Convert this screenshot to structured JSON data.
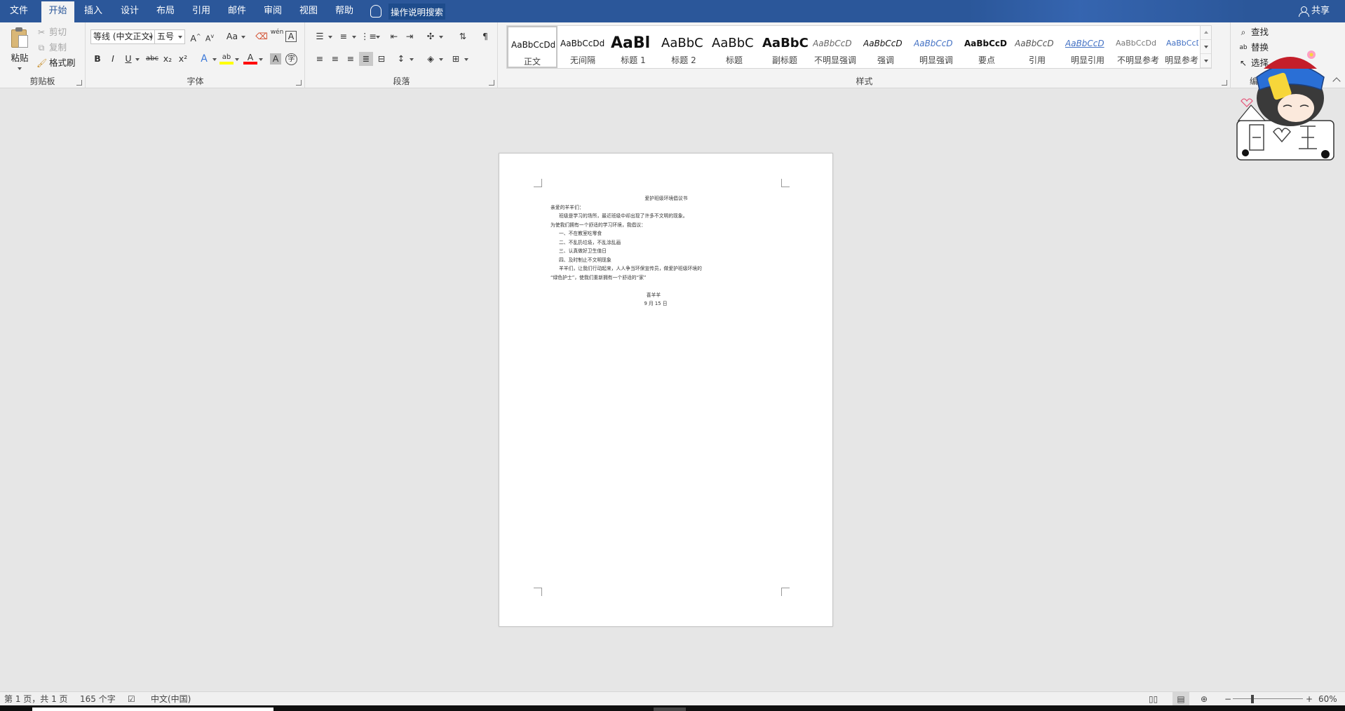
{
  "tabs": [
    {
      "label": "文件",
      "active": false
    },
    {
      "label": "开始",
      "active": true
    },
    {
      "label": "插入",
      "active": false
    },
    {
      "label": "设计",
      "active": false
    },
    {
      "label": "布局",
      "active": false
    },
    {
      "label": "引用",
      "active": false
    },
    {
      "label": "邮件",
      "active": false
    },
    {
      "label": "审阅",
      "active": false
    },
    {
      "label": "视图",
      "active": false
    },
    {
      "label": "帮助",
      "active": false
    }
  ],
  "tell_me": "操作说明搜索",
  "share": "共享",
  "clipboard": {
    "paste": "粘贴",
    "cut": "剪切",
    "copy": "复制",
    "format_painter": "格式刷",
    "label": "剪贴板"
  },
  "font": {
    "name": "等线 (中文正文)",
    "size": "五号",
    "label": "字体",
    "grow": "A",
    "shrink": "A",
    "case": "Aa",
    "phonetic": "wén",
    "border_char": "A",
    "bold": "B",
    "italic": "I",
    "underline": "U",
    "strike": "abc",
    "sub": "x₂",
    "sup": "x²",
    "effects": "A",
    "highlight": "ab",
    "color": "A",
    "shading": "A",
    "enclose": "字"
  },
  "paragraph": {
    "label": "段落"
  },
  "styles": {
    "label": "样式",
    "items": [
      {
        "sample": "AaBbCcDd",
        "name": "正文",
        "selected": true
      },
      {
        "sample": "AaBbCcDd",
        "name": "无间隔",
        "selected": false
      },
      {
        "sample": "AaBl",
        "name": "标题 1",
        "selected": false
      },
      {
        "sample": "AaBbC",
        "name": "标题 2",
        "selected": false
      },
      {
        "sample": "AaBbC",
        "name": "标题",
        "selected": false
      },
      {
        "sample": "AaBbC",
        "name": "副标题",
        "selected": false
      },
      {
        "sample": "AaBbCcD",
        "name": "不明显强调",
        "selected": false
      },
      {
        "sample": "AaBbCcD",
        "name": "强调",
        "selected": false
      },
      {
        "sample": "AaBbCcD",
        "name": "明显强调",
        "selected": false
      },
      {
        "sample": "AaBbCcD",
        "name": "要点",
        "selected": false
      },
      {
        "sample": "AaBbCcD",
        "name": "引用",
        "selected": false
      },
      {
        "sample": "AaBbCcD",
        "name": "明显引用",
        "selected": false
      },
      {
        "sample": "AaBbCcDd",
        "name": "不明显参考",
        "selected": false
      },
      {
        "sample": "AaBbCcDd",
        "name": "明显参考",
        "selected": false
      }
    ]
  },
  "editing": {
    "find": "查找",
    "replace": "替换",
    "select": "选择",
    "label": "编辑"
  },
  "document": {
    "title": "爱护班级环境倡议书",
    "lines": [
      "亲爱的羊羊们：",
      "班级是学习的场所，最近班级中却出现了许多不文明的现象。",
      "为使我们拥有一个舒适的学习环境，我倡议：",
      "一、不在教室吃零食",
      "二、不乱扔垃圾，不乱涂乱画",
      "三、认真做好卫生值日",
      "四、及时制止不文明现象",
      "羊羊们，让我们行动起来，人人争当环保宣传员，做爱护班级环境的",
      "“绿色护士”，使我们重新拥有一个舒适的“家”"
    ],
    "signature": "喜羊羊",
    "date": "9 月 15 日"
  },
  "status": {
    "page": "第 1 页，共 1 页",
    "words": "165 个字",
    "language": "中文(中国)",
    "zoom": "60%"
  },
  "colors": {
    "tab_bar": "#2b579a",
    "ribbon": "#f3f3f3",
    "canvas": "#e6e6e6"
  }
}
